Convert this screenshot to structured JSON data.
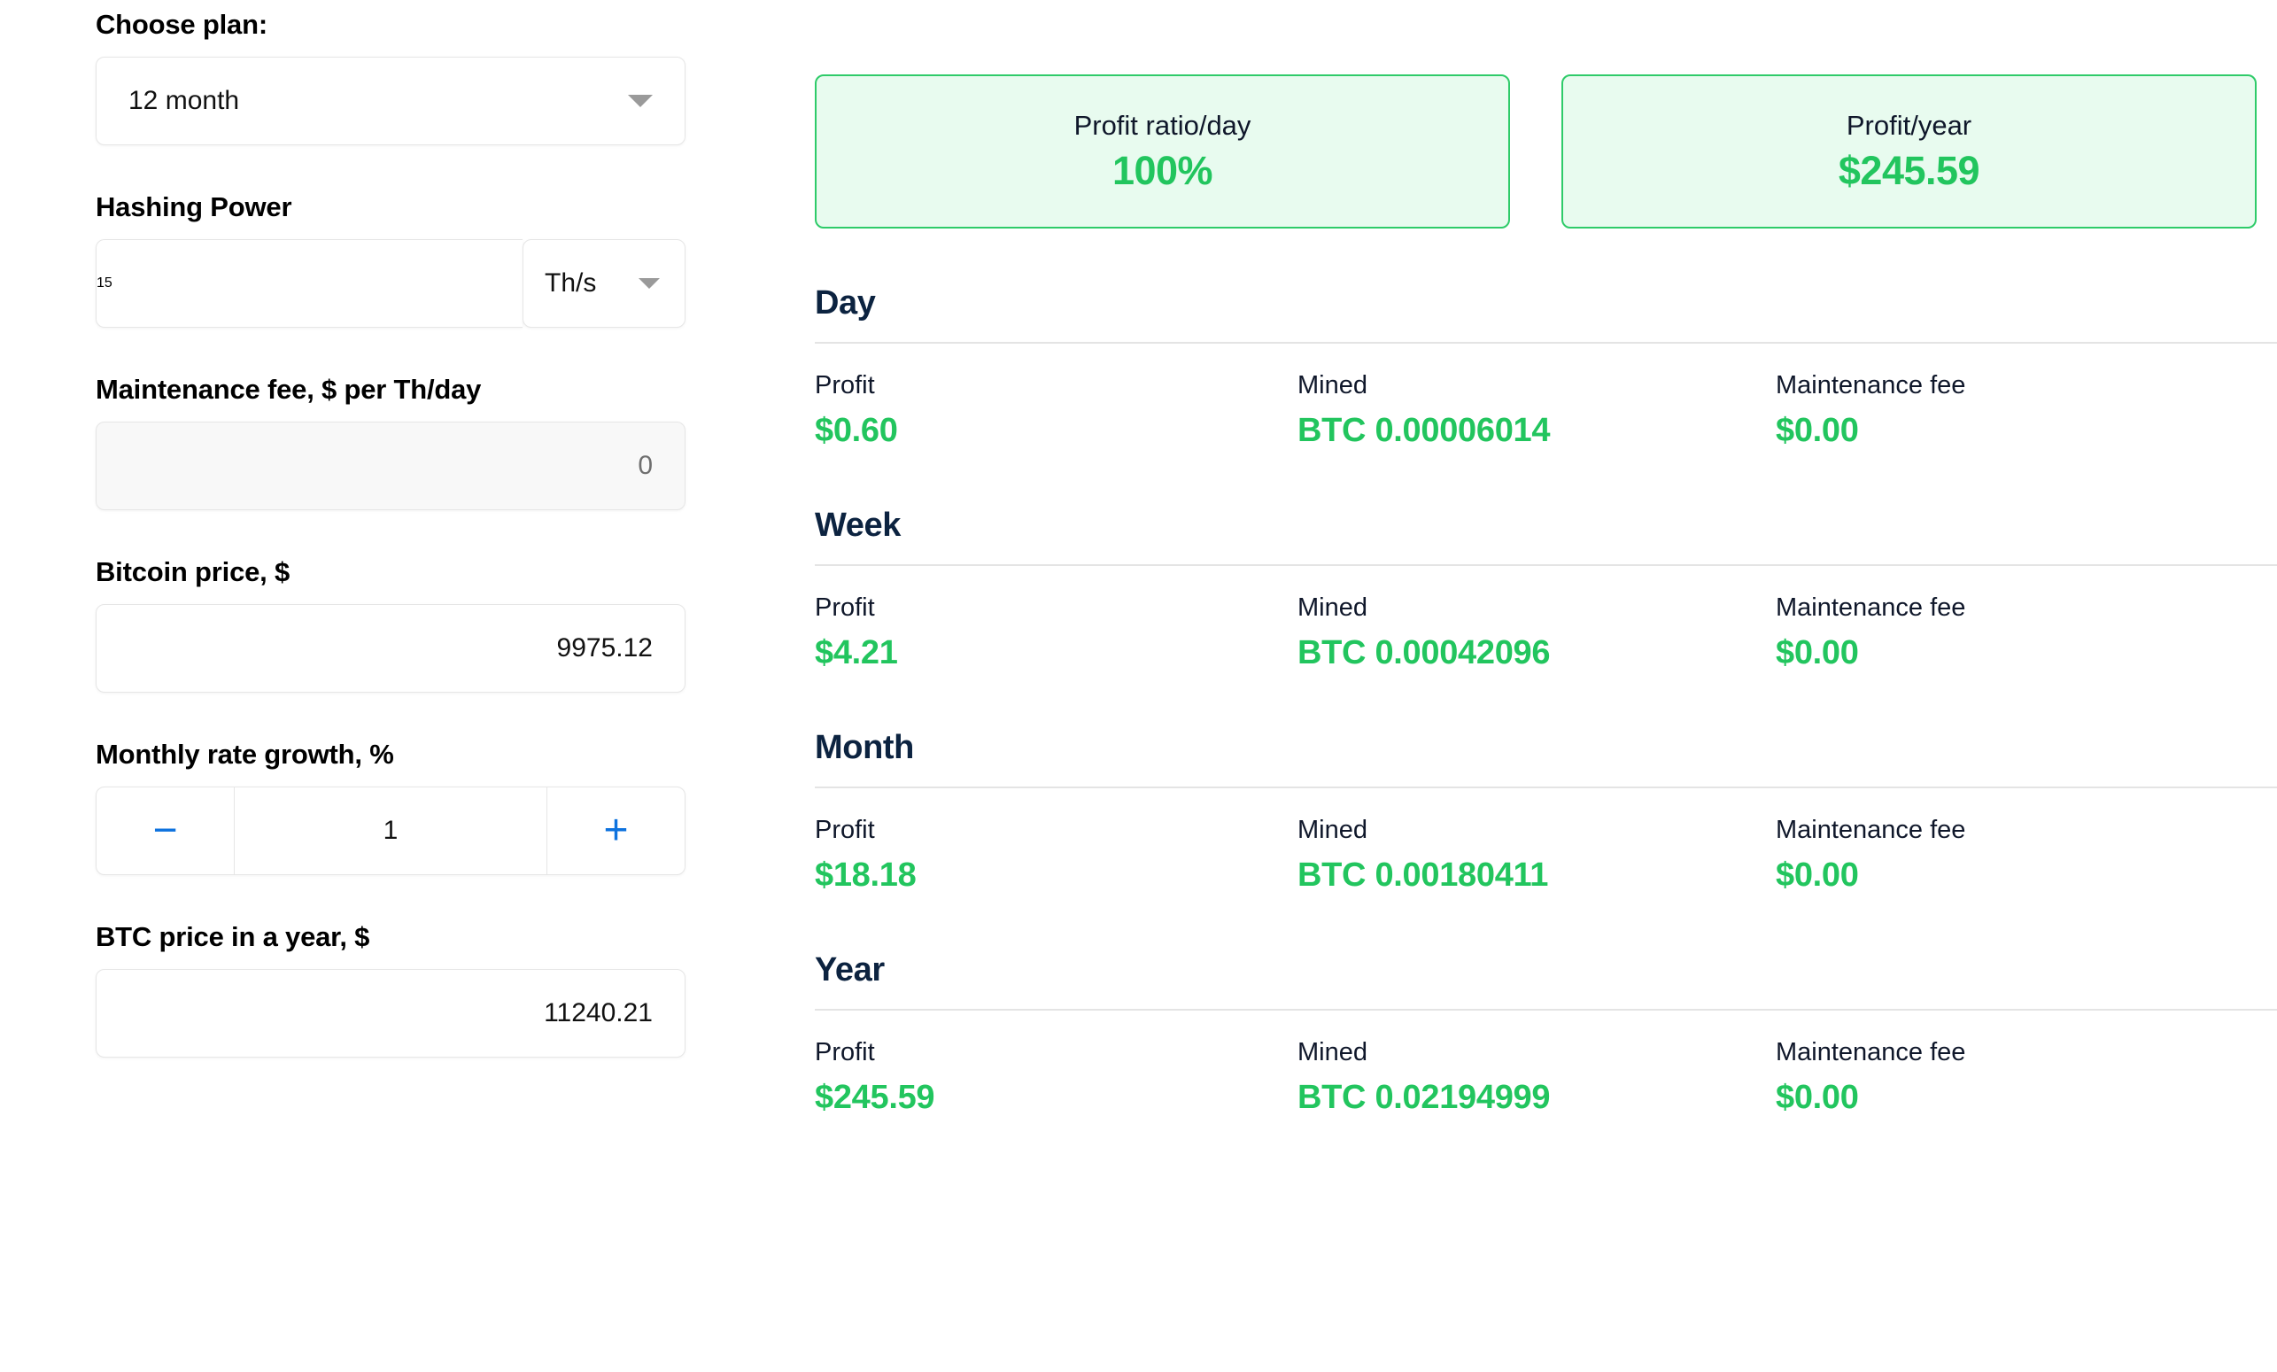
{
  "form": {
    "plan": {
      "label": "Choose plan:",
      "value": "12 month",
      "caret_icon": "chevron-down-icon"
    },
    "hashing_power": {
      "label": "Hashing Power",
      "value": "15",
      "unit": "Th/s",
      "caret_icon": "chevron-down-icon"
    },
    "maintenance_fee": {
      "label": "Maintenance fee, $ per Th/day",
      "value": "0"
    },
    "bitcoin_price": {
      "label": "Bitcoin price, $",
      "value": "9975.12"
    },
    "monthly_rate_growth": {
      "label": "Monthly rate growth, %",
      "value": "1",
      "decrement_label": "−",
      "increment_label": "+"
    },
    "btc_price_year": {
      "label": "BTC price in a year, $",
      "value": "11240.21"
    }
  },
  "summary_cards": [
    {
      "title": "Profit ratio/day",
      "value": "100%"
    },
    {
      "title": "Profit/year",
      "value": "$245.59"
    }
  ],
  "columns": {
    "profit": "Profit",
    "mined": "Mined",
    "maintenance_fee": "Maintenance fee"
  },
  "periods": [
    {
      "title": "Day",
      "profit": "$0.60",
      "mined": "BTC 0.00006014",
      "maintenance_fee": "$0.00"
    },
    {
      "title": "Week",
      "profit": "$4.21",
      "mined": "BTC 0.00042096",
      "maintenance_fee": "$0.00"
    },
    {
      "title": "Month",
      "profit": "$18.18",
      "mined": "BTC 0.00180411",
      "maintenance_fee": "$0.00"
    },
    {
      "title": "Year",
      "profit": "$245.59",
      "mined": "BTC 0.02194999",
      "maintenance_fee": "$0.00"
    }
  ],
  "colors": {
    "accent_green": "#22c55e",
    "card_bg": "#e8fbef",
    "card_border": "#2ecb69",
    "stepper_blue": "#0d72de",
    "heading_navy": "#0c2340"
  }
}
